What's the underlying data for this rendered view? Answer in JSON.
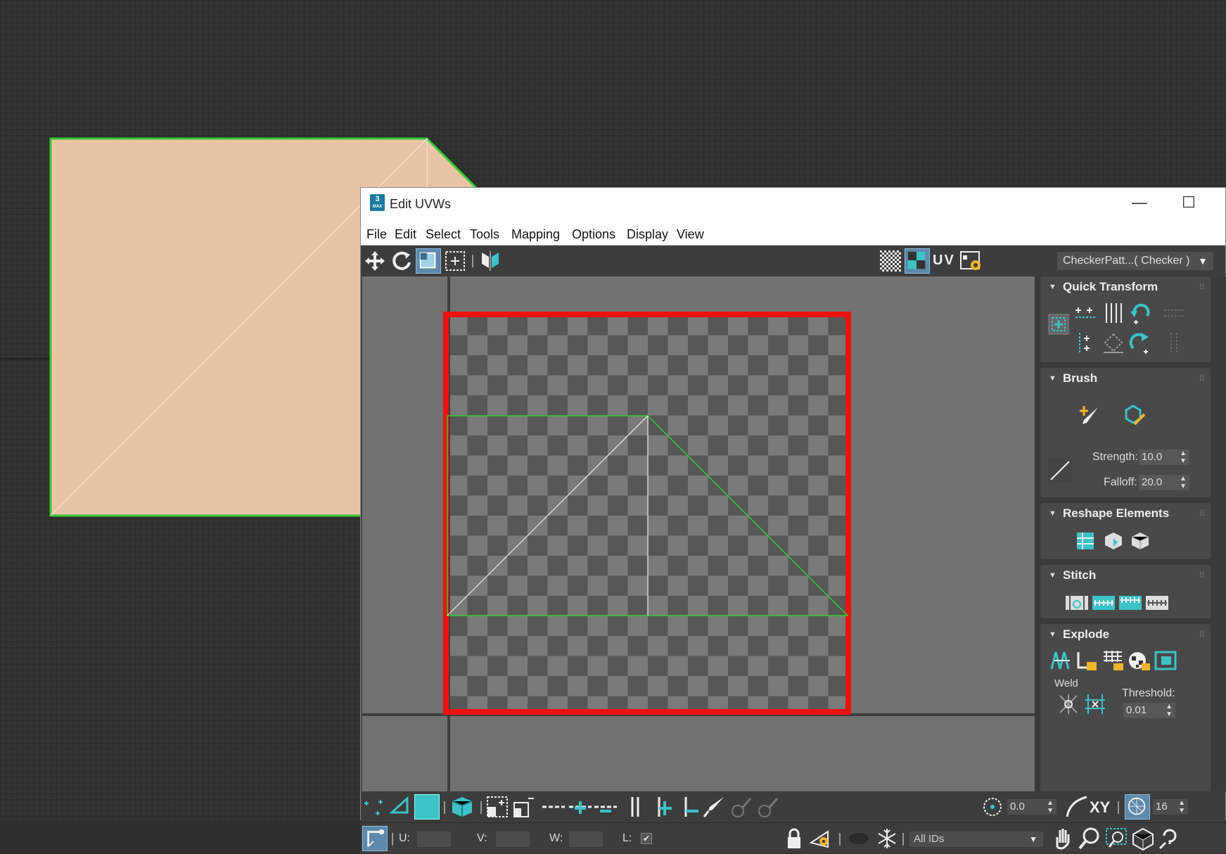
{
  "window": {
    "title": "Edit UVWs",
    "app_icon": {
      "number": "3",
      "sub": "MAX"
    },
    "controls": {
      "minimize": "—",
      "maximize": "☐",
      "close": "✕"
    }
  },
  "menu": [
    "File",
    "Edit",
    "Select",
    "Tools",
    "Mapping",
    "Options",
    "Display",
    "View"
  ],
  "toolbar": {
    "uv_label": "UV",
    "map_dropdown": "CheckerPatt...( Checker )"
  },
  "colors": {
    "selection_green": "#33cc33",
    "texture_frame_red": "#ee1111",
    "face_fill": "#e9c4a3",
    "accent_teal": "#3cc3c8"
  },
  "panel": {
    "quick_transform": "Quick Transform",
    "brush": {
      "title": "Brush",
      "strength_label": "Strength:",
      "strength_value": "10.0",
      "falloff_label": "Falloff:",
      "falloff_value": "20.0"
    },
    "reshape": "Reshape Elements",
    "stitch": "Stitch",
    "explode": {
      "title": "Explode",
      "weld_label": "Weld",
      "threshold_label": "Threshold:",
      "threshold_value": "0.01"
    }
  },
  "bottom": {
    "rotation_value": "0.0",
    "xy_label": "XY",
    "grid_value": "16",
    "u_label": "U:",
    "v_label": "V:",
    "w_label": "W:",
    "l_label": "L:",
    "l_checked": true,
    "ids_dropdown": "All IDs"
  }
}
